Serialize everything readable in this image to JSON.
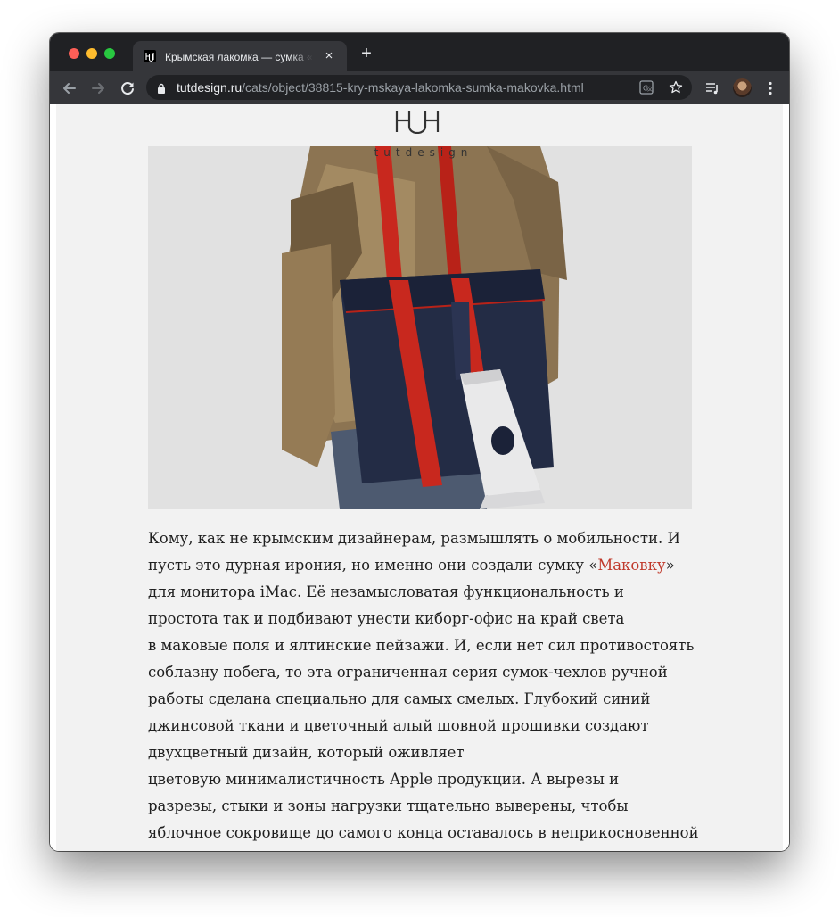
{
  "browser": {
    "tab": {
      "title": "Крымская лакомка — сумка «",
      "close": "×"
    },
    "new_tab": "+",
    "url_host": "tutdesign.ru",
    "url_path": "/cats/object/38815-kry-mskaya-lakomka-sumka-makovka.html",
    "colors": {
      "tab_strip": "#202124",
      "toolbar": "#35363a",
      "omnibox": "#202124"
    }
  },
  "site": {
    "logo_wordmark": "tutdesign"
  },
  "photo": {
    "subject": "man carrying a denim bag with red straps holding an iMac"
  },
  "article": {
    "lines": [
      {
        "text": "Кому, как не крымским дизайнерам, размышлять о мобильности. И"
      },
      {
        "before": "пусть это дурная ирония, но именно они создали сумку «",
        "link": "Маковку",
        "after": "»"
      },
      {
        "text": " для монитора iMac. Её незамысловатая функциональность и"
      },
      {
        "text": "простота так и подбивают унести киборг-офис на край света"
      },
      {
        "text": "в маковые поля и ялтинские пейзажи. И, если нет сил противостоять"
      },
      {
        "text": "соблазну побега, то эта ограниченная серия сумок-чехлов ручной"
      },
      {
        "text": "работы сделана специально для самых смелых. Глубокий синий"
      },
      {
        "text": "джинсовой ткани и цветочный алый шовной прошивки создают"
      },
      {
        "text": "двухцветный дизайн, который оживляет"
      },
      {
        "text": "цветовую минималистичность Apple продукции. А вырезы и"
      },
      {
        "text": "разрезы, стыки и зоны нагрузки тщательно выверены, чтобы"
      },
      {
        "text": "яблочное сокровище до самого конца оставалось в неприкосновенной"
      }
    ],
    "link_color": "#c0392b"
  }
}
